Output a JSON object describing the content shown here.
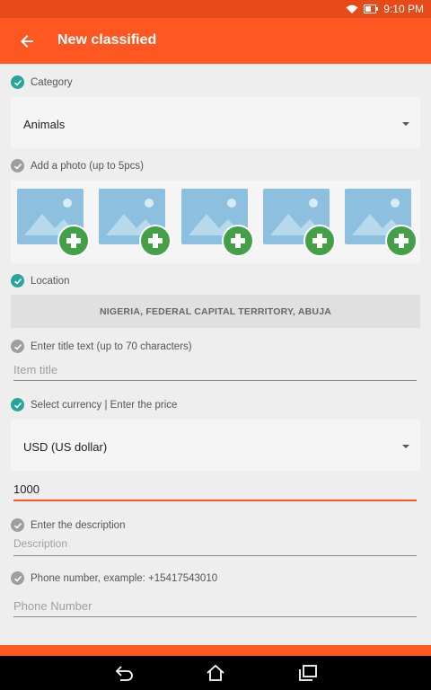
{
  "status": {
    "time": "9:10 PM"
  },
  "header": {
    "title": "New classified"
  },
  "category": {
    "label": "Category",
    "value": "Animals"
  },
  "photos": {
    "label": "Add a photo (up to 5pcs)",
    "count": 5
  },
  "location": {
    "label": "Location",
    "value": "NIGERIA, FEDERAL CAPITAL TERRITORY, ABUJA"
  },
  "title_field": {
    "label": "Enter title text (up to 70 characters)",
    "placeholder": "Item title"
  },
  "price": {
    "label": "Select currency | Enter the price",
    "currency": "USD (US dollar)",
    "value": "1000"
  },
  "description": {
    "label": "Enter the description",
    "placeholder": "Description"
  },
  "phone": {
    "label": "Phone number, example: +15417543010",
    "placeholder": "Phone Number"
  },
  "colors": {
    "accent": "#ff5722",
    "status": "#e64a19",
    "check_ok": "#26a69a",
    "check_off": "#9e9e9e",
    "add_button": "#43a047"
  },
  "icons": [
    "back-arrow-icon",
    "wifi-icon",
    "battery-icon",
    "check-icon",
    "dropdown-arrow-icon",
    "image-placeholder-icon",
    "add-icon",
    "nav-back-icon",
    "nav-home-icon",
    "nav-recents-icon"
  ]
}
